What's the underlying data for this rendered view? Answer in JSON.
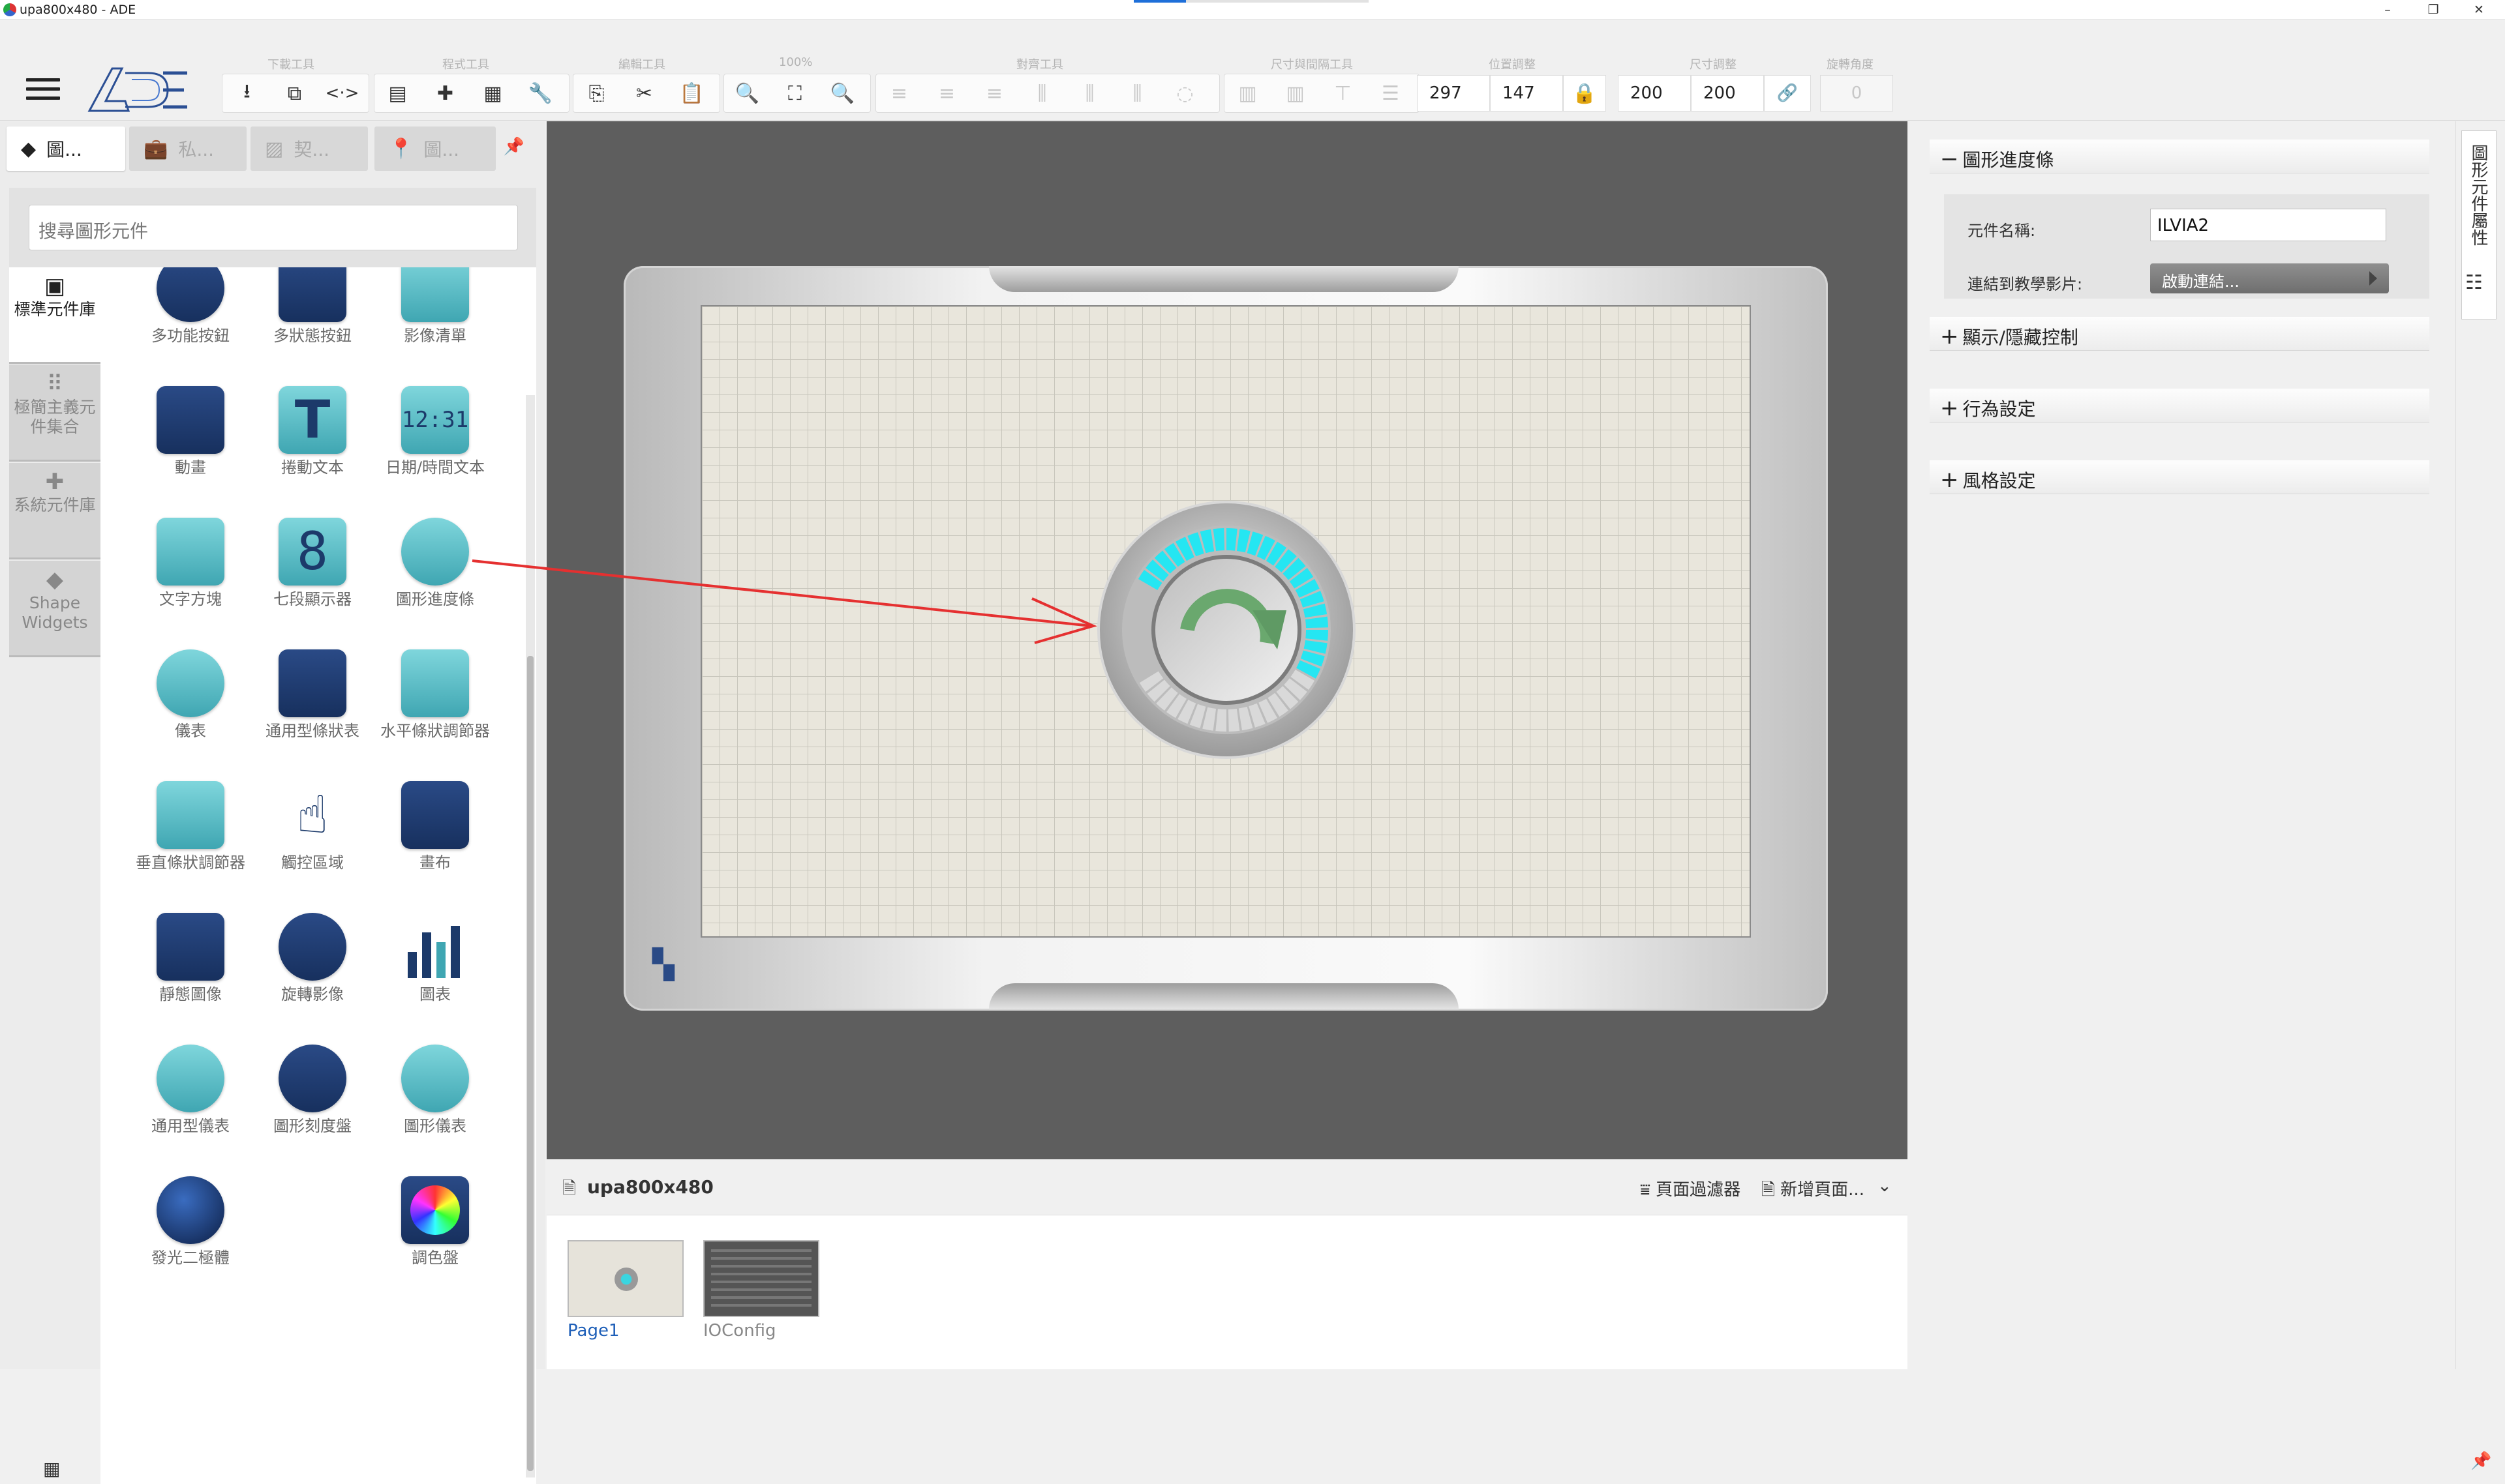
{
  "window": {
    "title": "upa800x480 - ADE",
    "controls": [
      "–",
      "❐",
      "✕"
    ]
  },
  "toolbar": {
    "groups": [
      {
        "label": "下載工具",
        "buttons": [
          "download-icon",
          "play-icon",
          "code-icon"
        ]
      },
      {
        "label": "程式工具",
        "buttons": [
          "storage-icon",
          "puzzle-icon",
          "components-icon",
          "wrench-icon"
        ]
      },
      {
        "label": "編輯工具",
        "buttons": [
          "copy-icon",
          "cut-icon",
          "paste-icon"
        ]
      },
      {
        "label": "100%",
        "buttons": [
          "zoom-out-icon",
          "fit-icon",
          "zoom-in-icon"
        ]
      },
      {
        "label": "對齊工具",
        "buttons": [
          "align-left-icon",
          "align-center-icon",
          "align-right-icon",
          "align-top-icon",
          "align-middle-icon",
          "align-bottom-icon",
          "align-extra-icon"
        ]
      },
      {
        "label": "尺寸與間隔工具",
        "buttons": [
          "size-1-icon",
          "size-2-icon",
          "size-3-icon",
          "size-4-icon"
        ]
      }
    ],
    "position": {
      "label": "位置調整",
      "x": "297",
      "y": "147"
    },
    "size": {
      "label": "尺寸調整",
      "w": "200",
      "h": "200"
    },
    "rotation": {
      "label": "旋轉角度",
      "value": "0"
    }
  },
  "left_panel": {
    "tabs": [
      {
        "label": "圖...",
        "icon": "layers-icon",
        "active": true
      },
      {
        "label": "私...",
        "icon": "briefcase-icon",
        "active": false
      },
      {
        "label": "契...",
        "icon": "image-icon",
        "active": false
      },
      {
        "label": "圖...",
        "icon": "location-pin-icon",
        "active": false
      }
    ],
    "search_placeholder": "搜尋圖形元件",
    "categories": [
      {
        "label": "標準元件庫",
        "icon": "widget-icon",
        "active": true
      },
      {
        "label": "極簡主義元件集合",
        "icon": "dots-grid-icon",
        "active": false
      },
      {
        "label": "系統元件庫",
        "icon": "puzzle-icon",
        "active": false
      },
      {
        "label": "Shape Widgets",
        "icon": "layers-icon",
        "active": false
      }
    ],
    "widgets": [
      {
        "label": "多功能按鈕",
        "icon": "multi-button-icon"
      },
      {
        "label": "多狀態按鈕",
        "icon": "multi-state-button-icon"
      },
      {
        "label": "影像清單",
        "icon": "image-list-icon"
      },
      {
        "label": "動畫",
        "icon": "animation-icon"
      },
      {
        "label": "捲動文本",
        "icon": "scroll-text-icon"
      },
      {
        "label": "日期/時間文本",
        "icon": "datetime-icon"
      },
      {
        "label": "文字方塊",
        "icon": "textbox-icon"
      },
      {
        "label": "七段顯示器",
        "icon": "seven-segment-icon"
      },
      {
        "label": "圖形進度條",
        "icon": "circular-progress-icon"
      },
      {
        "label": "儀表",
        "icon": "meter-icon"
      },
      {
        "label": "通用型條狀表",
        "icon": "bar-gauge-icon"
      },
      {
        "label": "水平條狀調節器",
        "icon": "h-slider-icon"
      },
      {
        "label": "垂直條狀調節器",
        "icon": "v-slider-icon"
      },
      {
        "label": "觸控區域",
        "icon": "touch-area-icon"
      },
      {
        "label": "畫布",
        "icon": "canvas-icon"
      },
      {
        "label": "靜態圖像",
        "icon": "static-image-icon"
      },
      {
        "label": "旋轉影像",
        "icon": "rotate-image-icon"
      },
      {
        "label": "圖表",
        "icon": "chart-icon"
      },
      {
        "label": "通用型儀表",
        "icon": "generic-gauge-icon"
      },
      {
        "label": "圖形刻度盤",
        "icon": "dial-icon"
      },
      {
        "label": "圖形儀表",
        "icon": "round-gauge-icon"
      },
      {
        "label": "發光二極體",
        "icon": "led-icon"
      },
      {
        "label": "調色盤",
        "icon": "palette-icon"
      }
    ]
  },
  "canvas": {
    "progress_fraction": 0.6
  },
  "pages": {
    "project": "upa800x480",
    "filter": "頁面過濾器",
    "add_page": "新增頁面...",
    "items": [
      {
        "name": "Page1",
        "selected": true
      },
      {
        "name": "IOConfig",
        "selected": false
      }
    ]
  },
  "properties": {
    "section_title": "圖形進度條",
    "name_label": "元件名稱:",
    "name_value": "ILVIA2",
    "link_label": "連結到教學影片:",
    "link_button": "啟動連結...",
    "sections": [
      "顯示/隱藏控制",
      "行為設定",
      "風格設定"
    ],
    "side_tab": "圖形元件屬性"
  },
  "colors": {
    "accent": "#1e6fd9",
    "progress": "#25e6f2",
    "widget_navy": "#1d3a70",
    "widget_teal": "#4fb8c2",
    "arrow": "#e53030"
  }
}
